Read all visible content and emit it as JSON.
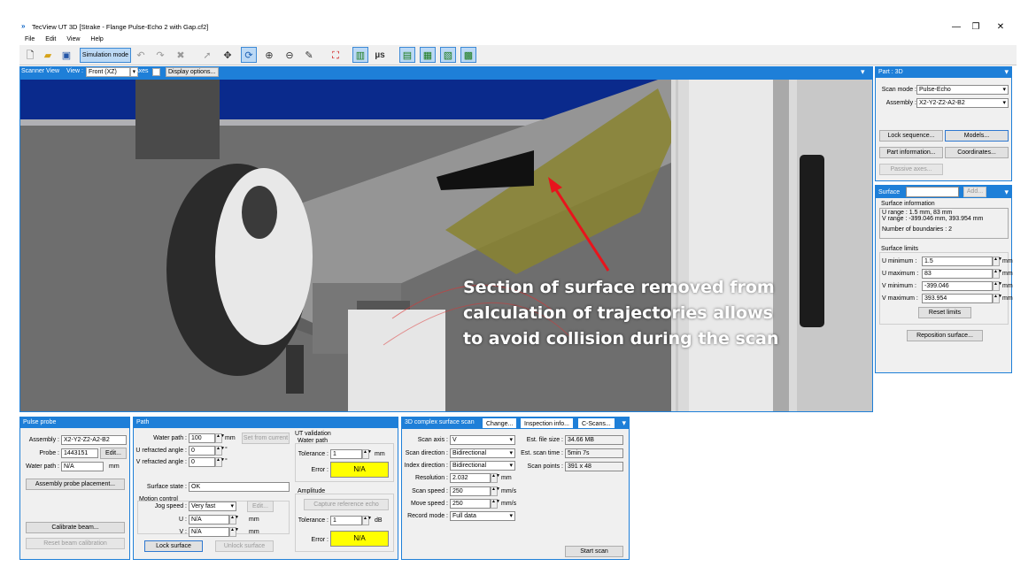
{
  "window": {
    "logo": "»",
    "title": "TecView UT 3D [Strake - Flange Pulse-Echo 2 with Gap.cf2]",
    "min": "—",
    "max": "❐",
    "close": "✕"
  },
  "menu": [
    "File",
    "Edit",
    "View",
    "Help"
  ],
  "toolbar": {
    "sim_mode": "Simulation mode",
    "mu_s": "µs"
  },
  "scanner_view": {
    "title": "Scanner View",
    "view_label": "View :",
    "view_value": "Front  (XZ)",
    "axes_label": "Axes",
    "display_options": "Display options...",
    "annotation": [
      "Section of surface removed from",
      "calculation of trajectories allows",
      "to avoid collision during the scan"
    ]
  },
  "part": {
    "title": "Part : 3D",
    "scan_mode_label": "Scan mode :",
    "scan_mode": "Pulse-Echo",
    "assembly_label": "Assembly :",
    "assembly": "X2-Y2-Z2-A2-B2",
    "lock_sequence": "Lock sequence...",
    "models": "Models...",
    "part_information": "Part information...",
    "coordinates": "Coordinates...",
    "passive_axes": "Passive axes..."
  },
  "surface": {
    "tab": "Surface",
    "side": "Side A",
    "add": "Add...",
    "info_title": "Surface information",
    "u_range": "U range : 1.5 mm, 83 mm",
    "v_range": "V range : -399.046 mm, 393.954 mm",
    "boundaries": "Number of boundaries : 2",
    "limits_title": "Surface limits",
    "u_min_label": "U minimum :",
    "u_min": "1.5",
    "u_max_label": "U maximum :",
    "u_max": "83",
    "v_min_label": "V minimum :",
    "v_min": "-399.046",
    "v_max_label": "V maximum :",
    "v_max": "393.954",
    "unit": "mm",
    "reset_limits": "Reset limits",
    "reposition": "Reposition surface..."
  },
  "pulse_probe": {
    "title": "Pulse probe",
    "assembly_label": "Assembly :",
    "assembly": "X2-Y2-Z2-A2-B2",
    "probe_label": "Probe :",
    "probe": "1443151",
    "edit": "Edit...",
    "water_path_label": "Water path :",
    "water_path": "N/A",
    "unit": "mm",
    "placement": "Assembly probe placement...",
    "calibrate": "Calibrate beam...",
    "reset_cal": "Reset beam calibration"
  },
  "path": {
    "title": "Path",
    "water_path_label": "Water path :",
    "water_path": "100",
    "mm": "mm",
    "set_from_current": "Set from current",
    "u_refr_label": "U refracted angle :",
    "u_refr": "0",
    "v_refr_label": "V refracted angle :",
    "v_refr": "0",
    "deg": "°",
    "surface_state_label": "Surface state :",
    "surface_state": "OK",
    "motion_control": "Motion control",
    "jog_label": "Jog speed :",
    "jog": "Very fast",
    "edit": "Edit...",
    "u_label": "U :",
    "u_val": "N/A",
    "v_label": "V :",
    "v_val": "N/A",
    "lock_surface": "Lock surface",
    "unlock_surface": "Unlock surface",
    "ut_validation": "UT validation",
    "water_path_sub": "Water path",
    "tolerance_label": "Tolerance :",
    "tolerance_wp": "1",
    "error_label": "Error :",
    "error_wp": "N/A",
    "amplitude": "Amplitude",
    "capture_ref": "Capture reference echo",
    "tolerance_amp": "1",
    "db": "dB",
    "error_amp": "N/A"
  },
  "scan": {
    "title": "3D complex surface scan",
    "tab_change": "Change...",
    "tab_inspection": "Inspection info...",
    "tab_cscans": "C-Scans...",
    "scan_axis_label": "Scan axis :",
    "scan_axis": "V",
    "scan_dir_label": "Scan direction :",
    "scan_dir": "Bidirectional",
    "index_dir_label": "Index direction :",
    "index_dir": "Bidirectional",
    "resolution_label": "Resolution :",
    "resolution": "2.032",
    "mm": "mm",
    "scan_speed_label": "Scan speed :",
    "scan_speed": "250",
    "mms": "mm/s",
    "move_speed_label": "Move speed :",
    "move_speed": "250",
    "record_label": "Record mode :",
    "record": "Full data",
    "file_size_label": "Est. file size :",
    "file_size": "34.66 MB",
    "scan_time_label": "Est. scan time :",
    "scan_time": "5min 7s",
    "scan_points_label": "Scan points :",
    "scan_points": "391 x 48",
    "start_scan": "Start scan"
  },
  "colors": {
    "accent": "#1e7fd8",
    "error_bg": "#ffff00",
    "arrow": "#e8141c",
    "floor": "#6b6b6b",
    "sky": "#0a2a8c"
  }
}
